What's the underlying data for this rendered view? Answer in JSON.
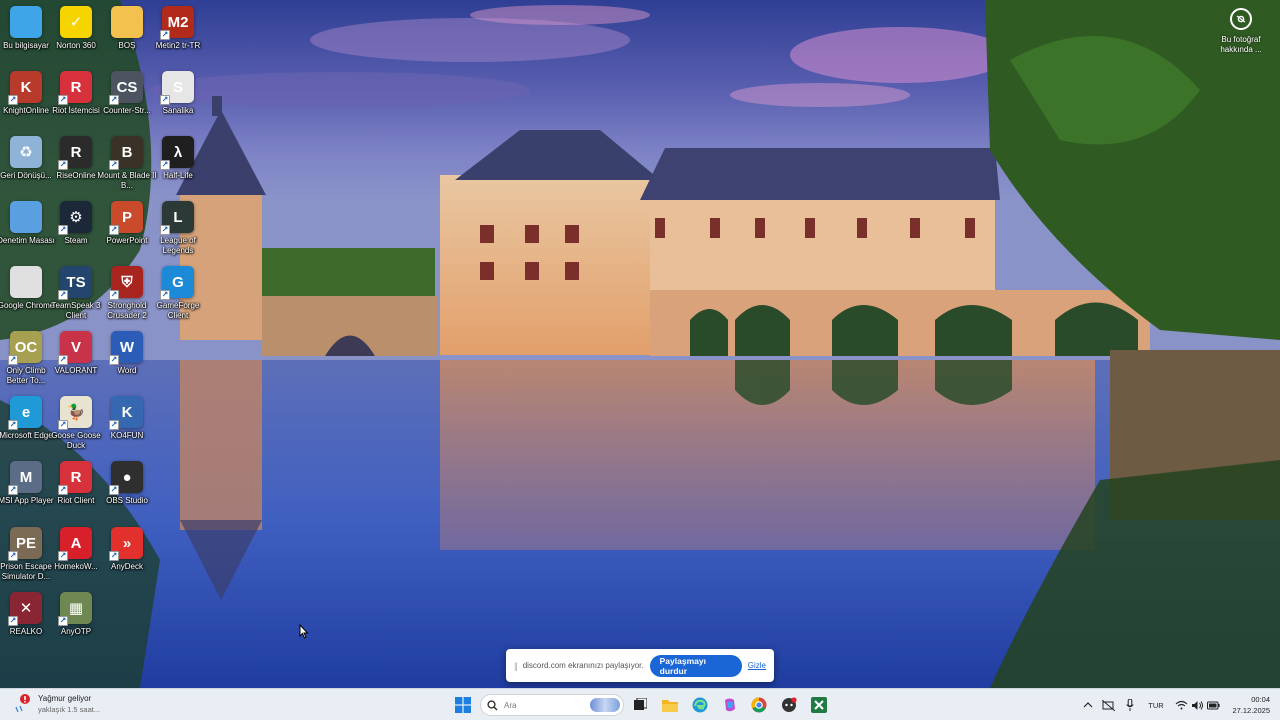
{
  "desktop": {
    "icons": [
      {
        "label": "Bu bilgisayar",
        "glyph": "",
        "color": "#3ea6e8"
      },
      {
        "label": "Norton 360",
        "glyph": "✓",
        "color": "#f5d400"
      },
      {
        "label": "BOŞ",
        "glyph": "",
        "color": "#f2c14e"
      },
      {
        "label": "Metin2 tr-TR",
        "glyph": "M2",
        "color": "#b22a1a"
      },
      {
        "label": "KnightOnline",
        "glyph": "K",
        "color": "#b73a2a"
      },
      {
        "label": "Riot İstemcisi",
        "glyph": "R",
        "color": "#d7323c"
      },
      {
        "label": "Counter-Str...",
        "glyph": "CS",
        "color": "#4d5360"
      },
      {
        "label": "Sanalika",
        "glyph": "S",
        "color": "#e6e6e6"
      },
      {
        "label": "Geri Dönüşü...",
        "glyph": "♻",
        "color": "#8fb3d6"
      },
      {
        "label": "RiseOnline",
        "glyph": "R",
        "color": "#2b2b2b"
      },
      {
        "label": "Mount & Blade II B...",
        "glyph": "B",
        "color": "#3a3226"
      },
      {
        "label": "Half-Life",
        "glyph": "λ",
        "color": "#1f1f1f"
      },
      {
        "label": "Denetim Masası",
        "glyph": "",
        "color": "#5aa0e0"
      },
      {
        "label": "Steam",
        "glyph": "⚙",
        "color": "#1b2838"
      },
      {
        "label": "PowerPoint",
        "glyph": "P",
        "color": "#c94b2b"
      },
      {
        "label": "League of Legends",
        "glyph": "L",
        "color": "#2b3a37"
      },
      {
        "label": "Google Chrome",
        "glyph": "",
        "color": "#e0e0e0"
      },
      {
        "label": "TeamSpeak 3 Client",
        "glyph": "TS",
        "color": "#24466e"
      },
      {
        "label": "Stronghold Crusader 2",
        "glyph": "⛨",
        "color": "#a8241f"
      },
      {
        "label": "GameForge Client",
        "glyph": "G",
        "color": "#1c8ad6"
      },
      {
        "label": "Only Climb Better To...",
        "glyph": "OC",
        "color": "#a7a050"
      },
      {
        "label": "VALORANT",
        "glyph": "V",
        "color": "#c8334a"
      },
      {
        "label": "Word",
        "glyph": "W",
        "color": "#2b5cb8"
      },
      {
        "label": "Microsoft Edge",
        "glyph": "e",
        "color": "#1f9ad6"
      },
      {
        "label": "Goose Goose Duck",
        "glyph": "🦆",
        "color": "#e8e2d0"
      },
      {
        "label": "KO4FUN",
        "glyph": "K",
        "color": "#3568b0"
      },
      {
        "label": "MSI App Player",
        "glyph": "M",
        "color": "#5b6d86"
      },
      {
        "label": "Riot Client",
        "glyph": "R",
        "color": "#d7323c"
      },
      {
        "label": "OBS Studio",
        "glyph": "●",
        "color": "#2f2f2f"
      },
      {
        "label": "Prison Escape Simulator D...",
        "glyph": "PE",
        "color": "#7b6a54"
      },
      {
        "label": "HomekoW...",
        "glyph": "A",
        "color": "#d8202a"
      },
      {
        "label": "AnyDeck",
        "glyph": "»",
        "color": "#e2312c"
      },
      {
        "label": "REALKO",
        "glyph": "✕",
        "color": "#8a2633"
      },
      {
        "label": "AnyOTP",
        "glyph": "▦",
        "color": "#6f8750"
      }
    ]
  },
  "photo_info": {
    "label": "Bu fotoğraf hakkında ...",
    "icon": "camera-icon"
  },
  "share_bar": {
    "grip": "||",
    "message": "discord.com ekranınızı paylaşıyor.",
    "stop_label": "Paylaşmayı durdur",
    "hide_label": "Gizle"
  },
  "taskbar": {
    "weather": {
      "title": "Yağmur geliyor",
      "subtitle": "yaklaşık 1.5 saat..."
    },
    "search_placeholder": "Ara",
    "apps": [
      "start-icon",
      "task-view-icon",
      "file-explorer-icon",
      "edge-icon",
      "copilot-icon",
      "chrome-icon",
      "discord-icon",
      "excel-icon"
    ],
    "language": "TUR",
    "time": "00:04",
    "date": "27.12.2025"
  }
}
